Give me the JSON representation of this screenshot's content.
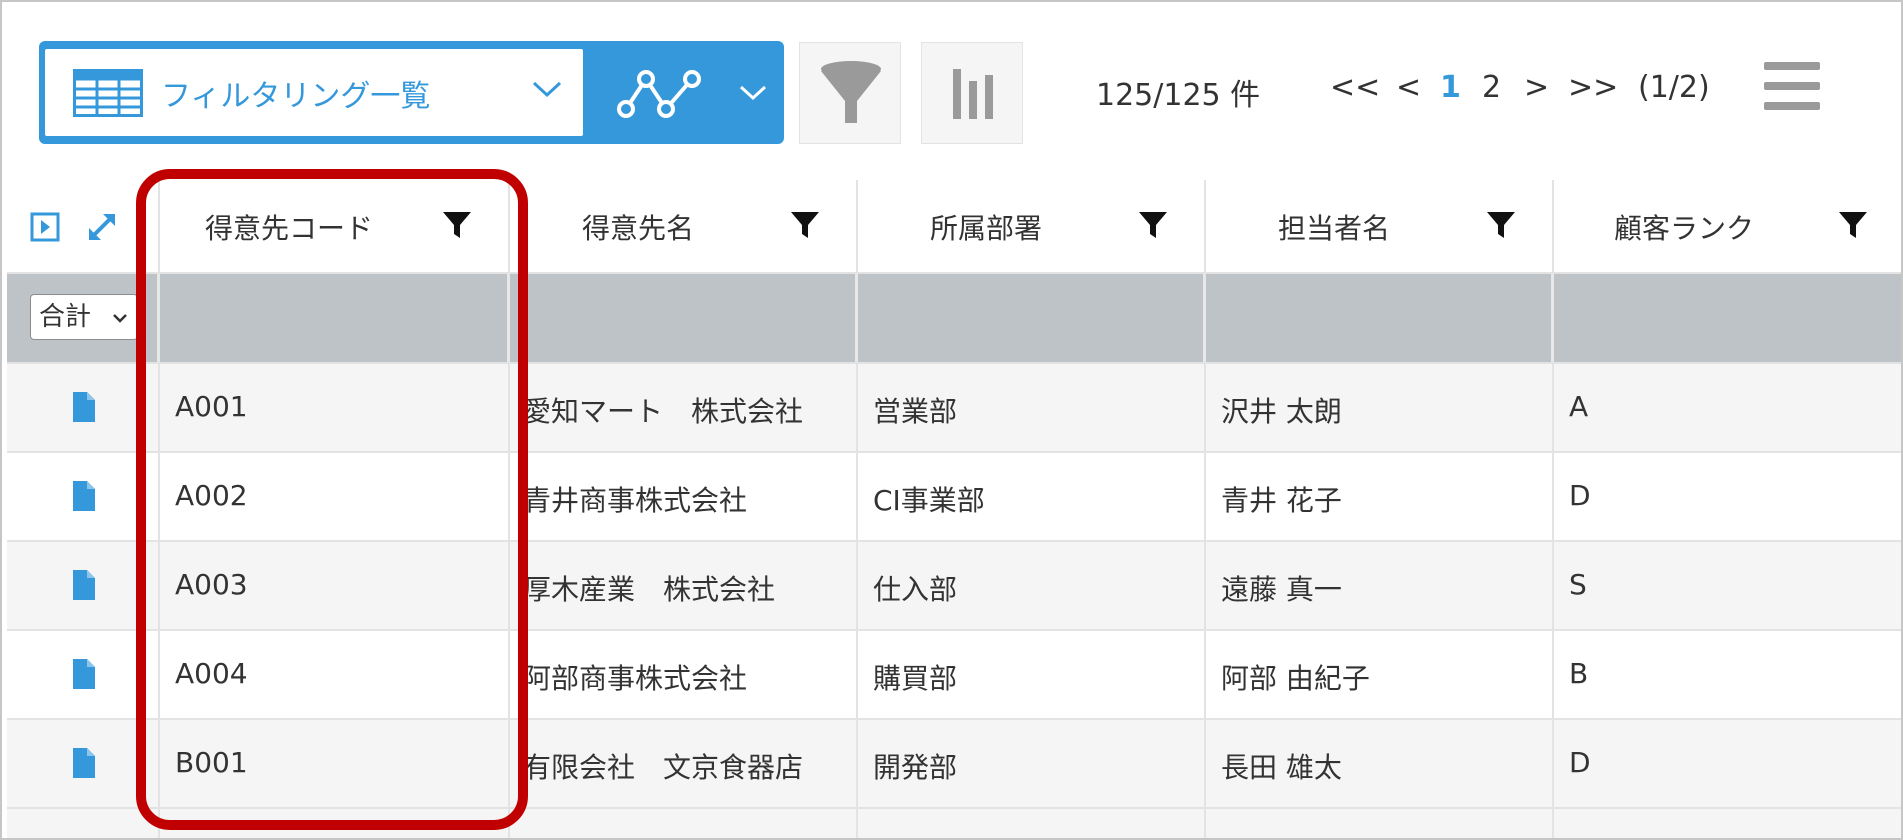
{
  "toolbar": {
    "view_name": "フィルタリング一覧",
    "record_count": "125/125 件",
    "pager": {
      "first": "<<",
      "prev": "<",
      "current": "1",
      "page2": "2",
      "next": ">",
      "last": ">>",
      "position": "(1/2)"
    }
  },
  "colors": {
    "accent": "#3498db",
    "highlight": "#c00000",
    "summary_bg": "#bec3c8"
  },
  "table": {
    "columns": [
      "得意先コード",
      "得意先名",
      "所属部署",
      "担当者名",
      "顧客ランク"
    ],
    "summary_select": "合計",
    "rows": [
      [
        "A001",
        "愛知マート　株式会社",
        "営業部",
        "沢井 太朗",
        "A"
      ],
      [
        "A002",
        "青井商事株式会社",
        "CI事業部",
        "青井 花子",
        "D"
      ],
      [
        "A003",
        "厚木産業　株式会社",
        "仕入部",
        "遠藤 真一",
        "S"
      ],
      [
        "A004",
        "阿部商事株式会社",
        "購買部",
        "阿部 由紀子",
        "B"
      ],
      [
        "B001",
        "有限会社　文京食器店",
        "開発部",
        "長田 雄太",
        "D"
      ]
    ]
  },
  "icons": {
    "view_icon": "table-icon",
    "graph_icon": "line-graph-icon",
    "filter_icon": "funnel-icon",
    "chart_icon": "bar-chart-icon",
    "menu_icon": "hamburger-icon",
    "row_icon": "document-icon"
  }
}
